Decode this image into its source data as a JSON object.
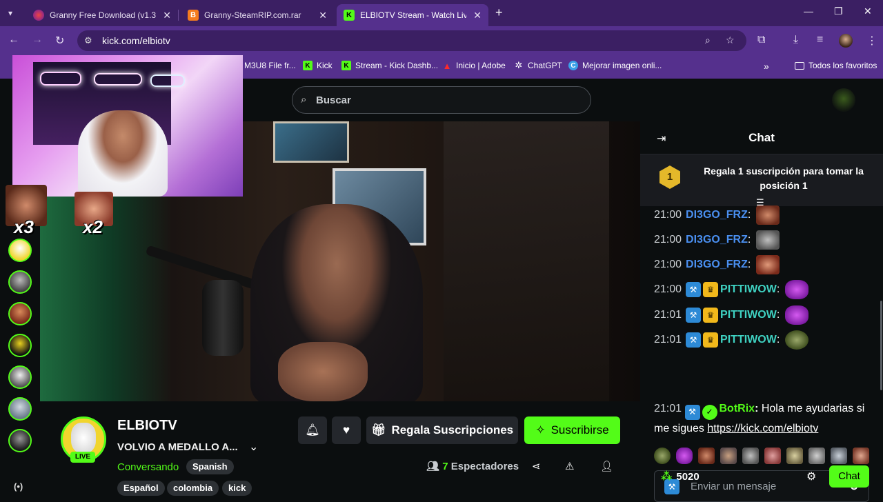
{
  "browser": {
    "tabs": [
      {
        "title": "Granny Free Download (v1.3.1)",
        "active": false
      },
      {
        "title": "Granny-SteamRIP.com.rar",
        "active": false
      },
      {
        "title": "ELBIOTV Stream - Watch Live on",
        "active": true
      }
    ],
    "url": "kick.com/elbiotv",
    "bookmarks": [
      {
        "label": "M3U8 File fr...",
        "icon": "file-icon"
      },
      {
        "label": "Kick",
        "icon": "kick-icon"
      },
      {
        "label": "Stream - Kick Dashb...",
        "icon": "kick-icon"
      },
      {
        "label": "Inicio | Adobe",
        "icon": "adobe-icon"
      },
      {
        "label": "ChatGPT",
        "icon": "chatgpt-icon"
      },
      {
        "label": "Mejorar imagen onli...",
        "icon": "enhance-icon"
      }
    ],
    "all_bookmarks": "Todos los favoritos"
  },
  "page": {
    "search_placeholder": "Buscar",
    "sticker_counts": [
      "x3",
      "x2"
    ]
  },
  "stream": {
    "streamer": "ELBIOTV",
    "live": "LIVE",
    "title": "VOLVIO A MEDALLO A...",
    "category": "Conversando",
    "language": "Spanish",
    "tags": [
      "Español",
      "colombia",
      "kick"
    ],
    "gift_label": "Regala Suscripciones",
    "subscribe_label": "Suscribirse",
    "viewers_count": "7",
    "viewers_label": "Espectadores"
  },
  "chat": {
    "title": "Chat",
    "pinned_rank": "1",
    "pinned_text": "Regala 1 suscripción para tomar la posición 1",
    "messages": [
      {
        "time": "21:00",
        "user": "DI3GO_FRZ",
        "color": "#4a8ff0"
      },
      {
        "time": "21:00",
        "user": "DI3GO_FRZ",
        "color": "#4a8ff0"
      },
      {
        "time": "21:00",
        "user": "DI3GO_FRZ",
        "color": "#4a8ff0"
      },
      {
        "time": "21:00",
        "user": "PITTIWOW",
        "color": "#3fd2c2"
      },
      {
        "time": "21:01",
        "user": "PITTIWOW",
        "color": "#3fd2c2"
      },
      {
        "time": "21:01",
        "user": "PITTIWOW",
        "color": "#3fd2c2"
      }
    ],
    "bot": {
      "time": "21:01",
      "user": "BotRix",
      "text": "Hola me ayudarias si me sigues",
      "link": "https://kick.com/elbiotv"
    },
    "input_placeholder": "Enviar un mensaje",
    "points": "5020",
    "send_label": "Chat"
  },
  "colors": {
    "kick_green": "#53fc18",
    "browser_dark": "#3b1f63",
    "browser_light": "#55308d"
  }
}
